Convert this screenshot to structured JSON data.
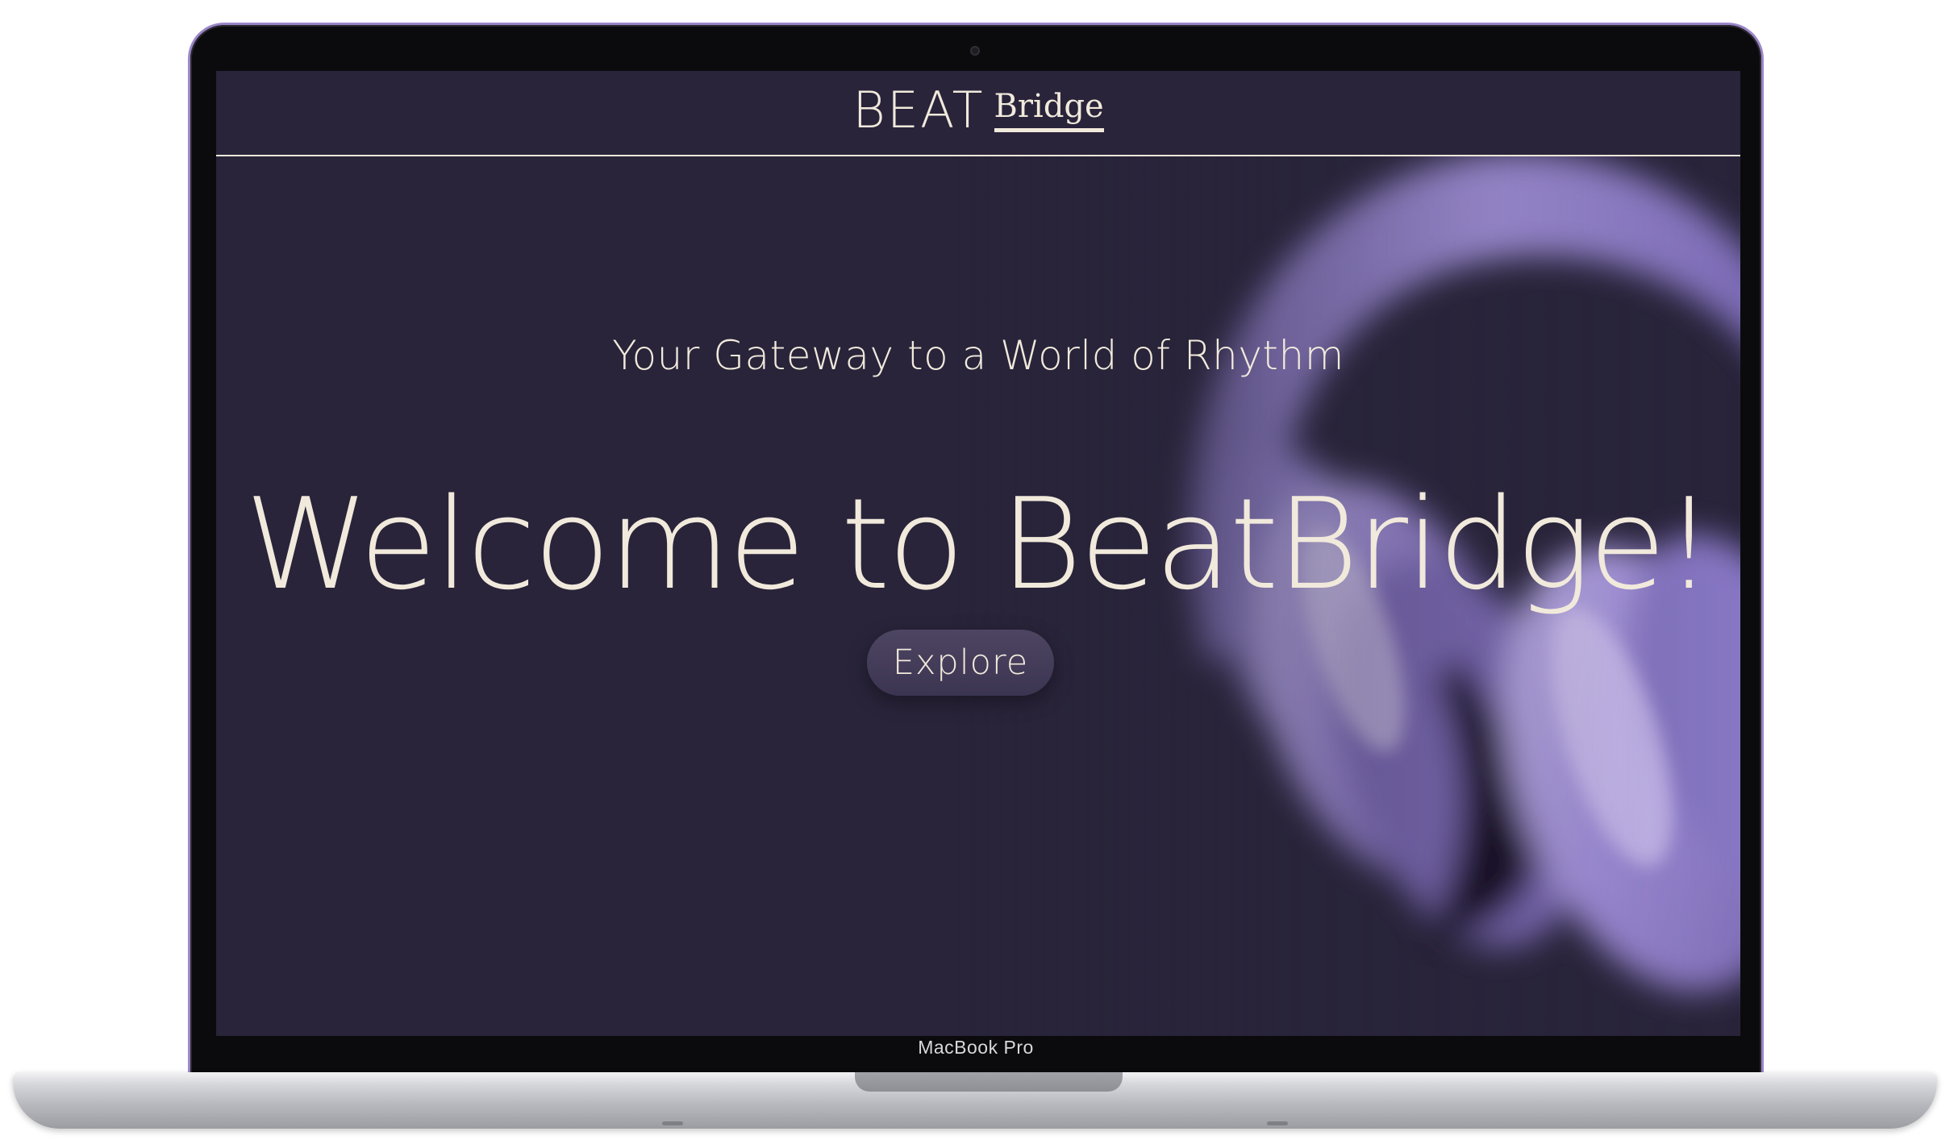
{
  "device": {
    "label": "MacBook Pro"
  },
  "site": {
    "logo": {
      "beat": "BEAT",
      "bridge": "Bridge"
    }
  },
  "hero": {
    "eyebrow": "Your Gateway to a World of Rhythm",
    "headline": "Welcome to BeatBridge!",
    "cta_label": "Explore",
    "image_icon": "headphones-icon"
  },
  "colors": {
    "background": "#29243a",
    "cream": "#f1eadc",
    "purple": "#9b86c9"
  }
}
